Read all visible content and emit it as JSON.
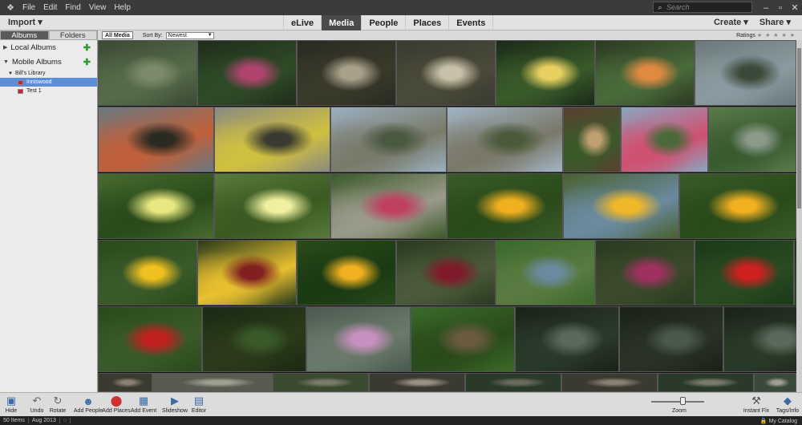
{
  "menubar": {
    "items": [
      "File",
      "Edit",
      "Find",
      "View",
      "Help"
    ],
    "search_placeholder": "Search"
  },
  "topbar": {
    "import_label": "Import",
    "tabs": [
      "eLive",
      "Media",
      "People",
      "Places",
      "Events"
    ],
    "active_tab": "Media",
    "create_label": "Create",
    "share_label": "Share"
  },
  "leftpanel": {
    "tabs": [
      "Albums",
      "Folders"
    ],
    "local_albums": "Local Albums",
    "mobile_albums": "Mobile Albums",
    "library": "Bill's Library",
    "albums": [
      "Inniswood",
      "Test 1"
    ],
    "selected_album": "Inniswood"
  },
  "gridbar": {
    "all_media": "All Media",
    "sort_label": "Sort By:",
    "sort_value": "Newest",
    "ratings_label": "Ratings",
    "stars": "★ ★ ★ ★ ★"
  },
  "grid": {
    "rows": [
      [
        {
          "c1": "#3a4a34",
          "c2": "#7a8a6a",
          "c3": "#556b4a"
        },
        {
          "c1": "#1e2e1a",
          "c2": "#b0446e",
          "c3": "#2f4a28"
        },
        {
          "c1": "#2a2a22",
          "c2": "#a8a08a",
          "c3": "#3a3a2a"
        },
        {
          "c1": "#3a3a2e",
          "c2": "#c8c0a8",
          "c3": "#4a4a3a"
        },
        {
          "c1": "#1a2a18",
          "c2": "#e8d060",
          "c3": "#3a5a2a"
        },
        {
          "c1": "#2a3a22",
          "c2": "#e08a40",
          "c3": "#4a6a3a"
        },
        {
          "c1": "#6a7a7a",
          "c2": "#3a4a3a",
          "c3": "#8a9aa0"
        }
      ],
      [
        {
          "c1": "#6a7880",
          "c2": "#2a2a22",
          "c3": "#c0603a"
        },
        {
          "c1": "#8a8a80",
          "c2": "#3a3a30",
          "c3": "#d0c040"
        },
        {
          "c1": "#9ab0c0",
          "c2": "#4a5a40",
          "c3": "#7a7a6a"
        },
        {
          "c1": "#a0b4c4",
          "c2": "#4a5a3a",
          "c3": "#7a7868"
        },
        {
          "c1": "#5a4030",
          "c2": "#c0a070",
          "c3": "#3a5a2a"
        },
        {
          "c1": "#8aa6c0",
          "c2": "#4a6a3a",
          "c3": "#d05070"
        },
        {
          "c1": "#5a7a4a",
          "c2": "#8a9a8a",
          "c3": "#3a5a30"
        }
      ],
      [
        {
          "c1": "#4a6a30",
          "c2": "#e8e880",
          "c3": "#2a4a1a"
        },
        {
          "c1": "#5a7a3a",
          "c2": "#f0f0a0",
          "c3": "#3a5a20"
        },
        {
          "c1": "#3a5a2a",
          "c2": "#c04060",
          "c3": "#9a9a8a"
        },
        {
          "c1": "#3a5a28",
          "c2": "#f0b020",
          "c3": "#2a4a1a"
        },
        {
          "c1": "#4a6030",
          "c2": "#f0b828",
          "c3": "#6a8aa0"
        },
        {
          "c1": "#3a5a28",
          "c2": "#f0b020",
          "c3": "#2a4a1a"
        }
      ],
      [
        {
          "c1": "#2a4a1a",
          "c2": "#f0c020",
          "c3": "#3a5a2a"
        },
        {
          "c1": "#2a3a1a",
          "c2": "#802020",
          "c3": "#e8c030"
        },
        {
          "c1": "#2a4a1a",
          "c2": "#f0b020",
          "c3": "#1a3a12"
        },
        {
          "c1": "#2a3a20",
          "c2": "#801a2a",
          "c3": "#4a5a3a"
        },
        {
          "c1": "#3a6a2a",
          "c2": "#6a8aa0",
          "c3": "#5a7a40"
        },
        {
          "c1": "#2a3a20",
          "c2": "#a03060",
          "c3": "#3a4a2a"
        },
        {
          "c1": "#1a3a18",
          "c2": "#d02020",
          "c3": "#2a4a22"
        },
        {
          "c1": "#1a3a18",
          "c2": "#d82020",
          "c3": "#2a4a22"
        }
      ],
      [
        {
          "c1": "#2a4a1a",
          "c2": "#c02020",
          "c3": "#3a5a2a"
        },
        {
          "c1": "#1a2a14",
          "c2": "#3a5a2a",
          "c3": "#2a3a1a"
        },
        {
          "c1": "#4a5a50",
          "c2": "#c890c0",
          "c3": "#6a7a6a"
        },
        {
          "c1": "#3a6a2a",
          "c2": "#6a5a40",
          "c3": "#2a4a1a"
        },
        {
          "c1": "#1a2218",
          "c2": "#5a6a5a",
          "c3": "#2a3a2a"
        },
        {
          "c1": "#1a2218",
          "c2": "#4a5a4a",
          "c3": "#2a3228"
        },
        {
          "c1": "#1a2218",
          "c2": "#5a6a5a",
          "c3": "#2a3a28"
        },
        {
          "c1": "#2a3a3a",
          "c2": "#8aa0b0",
          "c3": "#4a5a5a"
        },
        {
          "c1": "#3a4a48",
          "c2": "#c0c8d0",
          "c3": "#5a6a60"
        }
      ],
      [
        {
          "c1": "#3a3a30",
          "c2": "#8a8070"
        },
        {
          "c1": "#5a5a50",
          "c2": "#a0a090"
        },
        {
          "c1": "#3a4a30",
          "c2": "#7a7a6a"
        },
        {
          "c1": "#3a3a32",
          "c2": "#9a9080"
        },
        {
          "c1": "#2a3a28",
          "c2": "#6a6a5a"
        },
        {
          "c1": "#3a3a30",
          "c2": "#8a8070"
        },
        {
          "c1": "#2a3a28",
          "c2": "#7a7a6a"
        },
        {
          "c1": "#3a4a3a",
          "c2": "#a0a090"
        }
      ]
    ]
  },
  "bottombar": {
    "tools": [
      "Hide",
      "Undo",
      "Rotate",
      "Add People",
      "Add Places",
      "Add Event",
      "Slideshow",
      "Editor"
    ],
    "zoom_label": "Zoom",
    "instant_fix": "Instant Fix",
    "tags_info": "Tags/Info"
  },
  "status": {
    "items": "50 Items",
    "date": "Aug 2013",
    "catalog": "My Catalog"
  }
}
